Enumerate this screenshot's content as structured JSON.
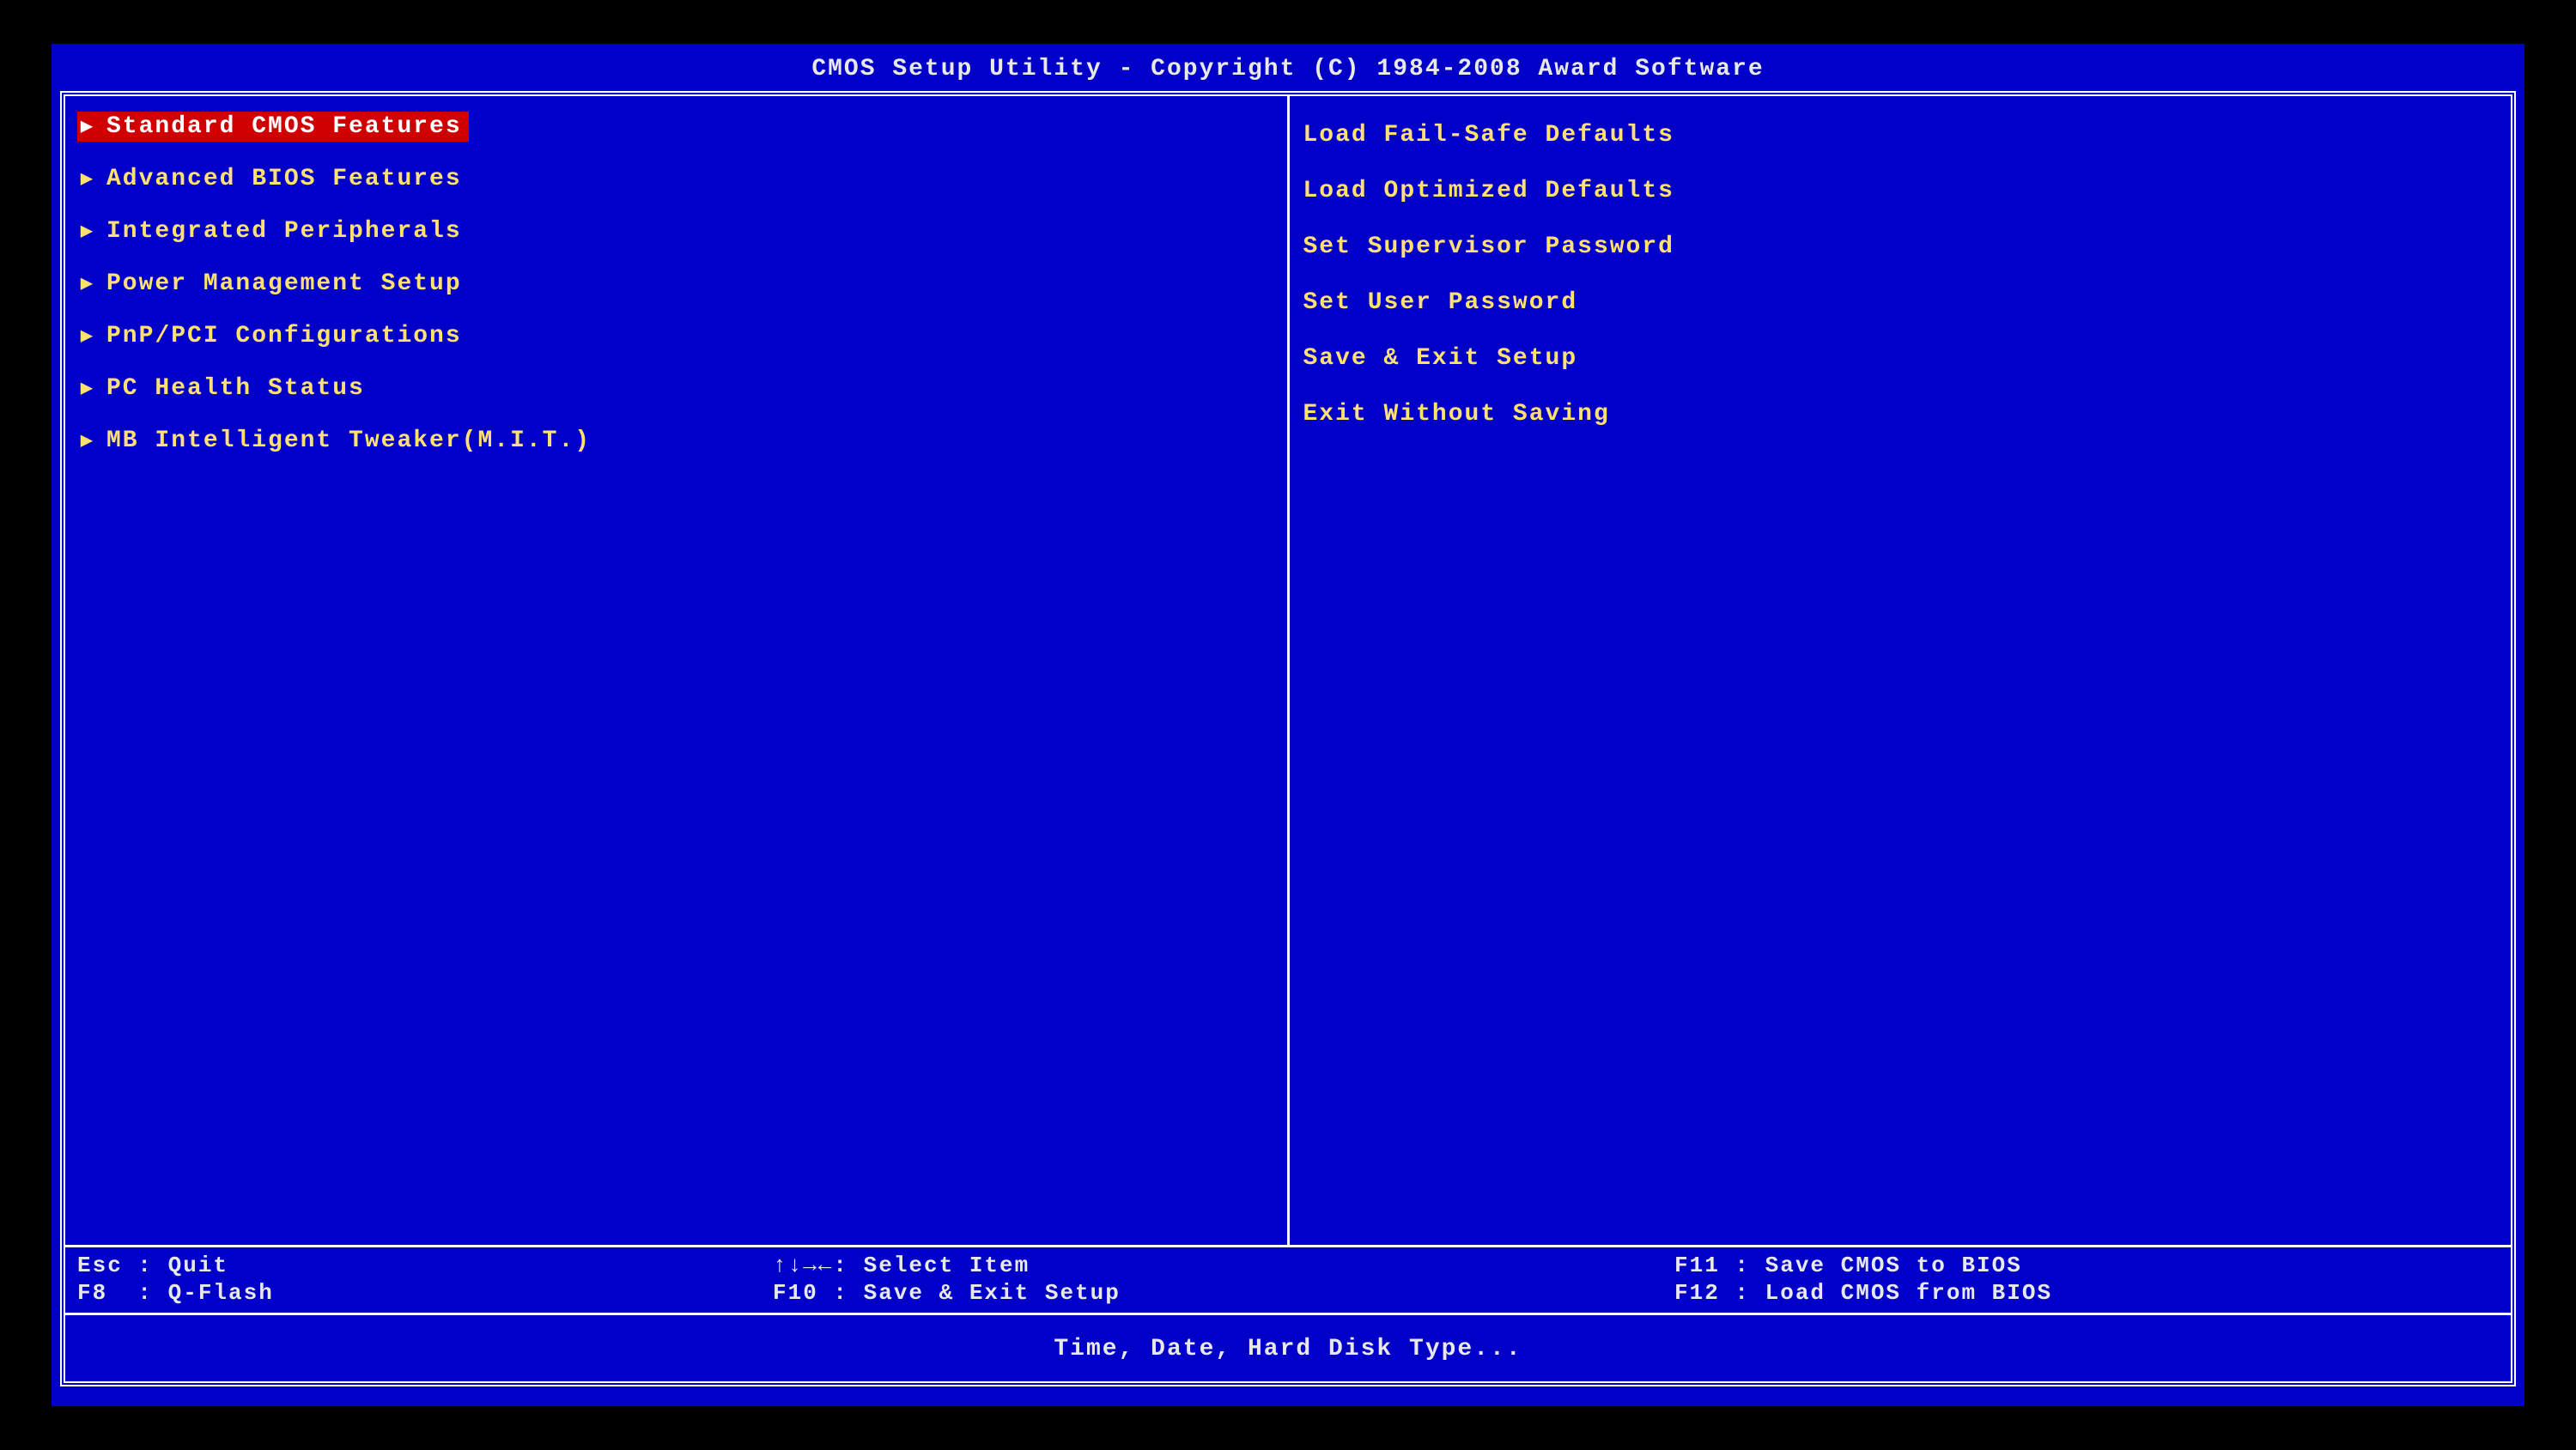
{
  "title": "CMOS Setup Utility - Copyright (C) 1984-2008 Award Software",
  "left_menu": [
    {
      "label": "Standard CMOS Features",
      "selected": true
    },
    {
      "label": "Advanced BIOS Features",
      "selected": false
    },
    {
      "label": "Integrated Peripherals",
      "selected": false
    },
    {
      "label": "Power Management Setup",
      "selected": false
    },
    {
      "label": "PnP/PCI Configurations",
      "selected": false
    },
    {
      "label": "PC Health Status",
      "selected": false
    },
    {
      "label": "MB Intelligent Tweaker(M.I.T.)",
      "selected": false
    }
  ],
  "right_menu": [
    {
      "label": "Load Fail-Safe Defaults"
    },
    {
      "label": "Load Optimized Defaults"
    },
    {
      "label": "Set Supervisor Password"
    },
    {
      "label": "Set User Password"
    },
    {
      "label": "Save & Exit Setup"
    },
    {
      "label": "Exit Without Saving"
    }
  ],
  "footer": {
    "r1c1": "Esc : Quit",
    "r1c2": "↑↓→←: Select Item",
    "r1c3": "F11 : Save CMOS to BIOS",
    "r2c1": "F8  : Q-Flash",
    "r2c2": "F10 : Save & Exit Setup",
    "r2c3": "F12 : Load CMOS from BIOS"
  },
  "hint": "Time, Date, Hard Disk Type..."
}
